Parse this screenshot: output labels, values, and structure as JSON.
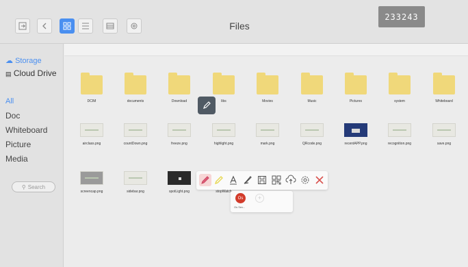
{
  "header": {
    "title": "Files",
    "session_code": "233243"
  },
  "sidebar": {
    "sources": [
      {
        "label": "Storage",
        "icon": "storage-icon"
      },
      {
        "label": "Cloud Drive",
        "icon": "cloud-drive-icon"
      }
    ],
    "categories": [
      {
        "label": "All"
      },
      {
        "label": "Doc"
      },
      {
        "label": "Whiteboard"
      },
      {
        "label": "Picture"
      },
      {
        "label": "Media"
      }
    ],
    "search_label": "Search"
  },
  "files": {
    "folders": [
      "DCIM",
      "documents",
      "Download",
      "libs",
      "Movies",
      "Music",
      "Pictures",
      "system",
      "Whiteboard"
    ],
    "images_row1": [
      "airclass.png",
      "countDown.png",
      "freeze.png",
      "highlight.png",
      "mark.png",
      "QRcode.png",
      "recentAPP.png",
      "recognition.png",
      "save.png"
    ],
    "images_row2": [
      "screencap.png",
      "sidebar.png",
      "spotLight.png",
      "stopWatch"
    ]
  },
  "annotation_toolbar": {
    "tools": [
      "pen-icon",
      "highlighter-icon",
      "text-icon",
      "eraser-icon",
      "save-icon",
      "qrcode-icon",
      "upload-icon",
      "settings-icon",
      "close-icon"
    ]
  },
  "user_popup": {
    "initials": "Os",
    "name": "Os Sev..."
  },
  "colors": {
    "accent": "#4a8ff0",
    "folder": "#f0d87a",
    "close": "#d9534f",
    "badge": "#d23b2a"
  }
}
